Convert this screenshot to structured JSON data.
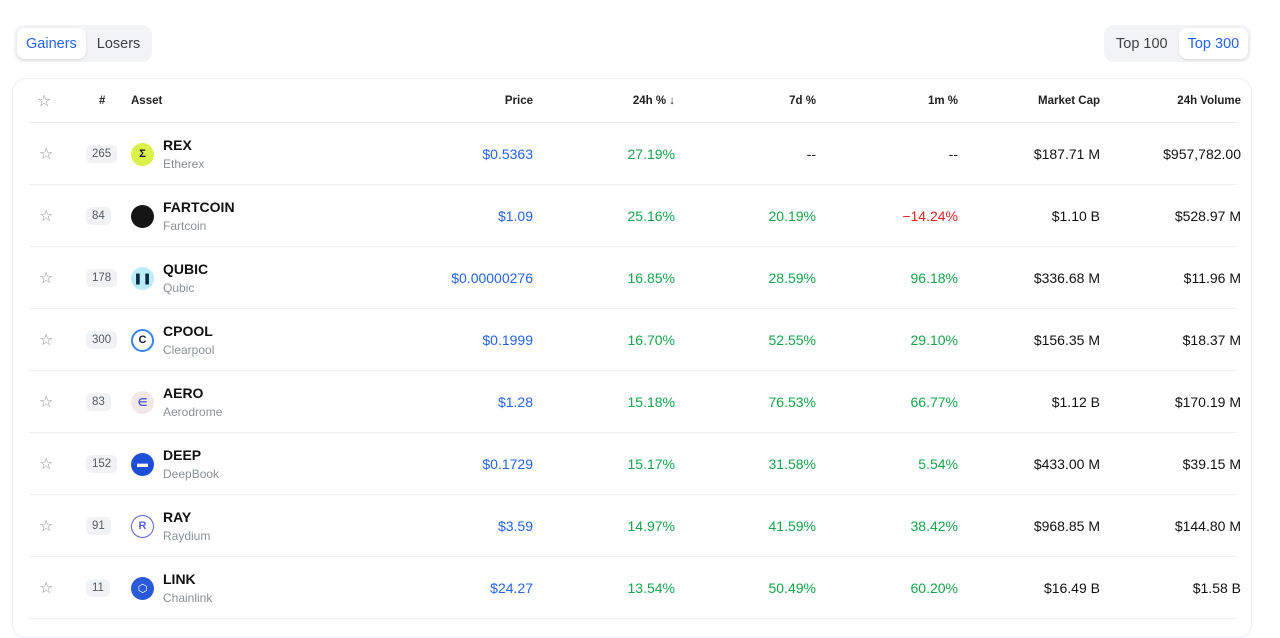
{
  "tabs": {
    "gainers": "Gainers",
    "losers": "Losers"
  },
  "filters": {
    "top100": "Top 100",
    "top300": "Top 300"
  },
  "headers": {
    "rank": "#",
    "asset": "Asset",
    "price": "Price",
    "change_24h": "24h % ↓",
    "change_7d": "7d %",
    "change_1m": "1m %",
    "market_cap": "Market Cap",
    "volume_24h": "24h Volume"
  },
  "colors": {
    "accent": "#2563eb",
    "positive": "#16a34a",
    "negative": "#dc2626"
  },
  "rows": [
    {
      "rank": "265",
      "symbol": "REX",
      "name": "Etherex",
      "price": "$0.5363",
      "d24": "27.19%",
      "d7": "--",
      "m1": "--",
      "mcap": "$187.71 M",
      "vol": "$957,782.00",
      "icon": "sigma-icon"
    },
    {
      "rank": "84",
      "symbol": "FARTCOIN",
      "name": "Fartcoin",
      "price": "$1.09",
      "d24": "25.16%",
      "d7": "20.19%",
      "m1": "−14.24%",
      "mcap": "$1.10 B",
      "vol": "$528.97 M",
      "icon": "dark-circle-icon"
    },
    {
      "rank": "178",
      "symbol": "QUBIC",
      "name": "Qubic",
      "price": "$0.00000276",
      "d24": "16.85%",
      "d7": "28.59%",
      "m1": "96.18%",
      "mcap": "$336.68 M",
      "vol": "$11.96 M",
      "icon": "bars-icon"
    },
    {
      "rank": "300",
      "symbol": "CPOOL",
      "name": "Clearpool",
      "price": "$0.1999",
      "d24": "16.70%",
      "d7": "52.55%",
      "m1": "29.10%",
      "mcap": "$156.35 M",
      "vol": "$18.37 M",
      "icon": "c-icon"
    },
    {
      "rank": "83",
      "symbol": "AERO",
      "name": "Aerodrome",
      "price": "$1.28",
      "d24": "15.18%",
      "d7": "76.53%",
      "m1": "66.77%",
      "mcap": "$1.12 B",
      "vol": "$170.19 M",
      "icon": "aero-icon"
    },
    {
      "rank": "152",
      "symbol": "DEEP",
      "name": "DeepBook",
      "price": "$0.1729",
      "d24": "15.17%",
      "d7": "31.58%",
      "m1": "5.54%",
      "mcap": "$433.00 M",
      "vol": "$39.15 M",
      "icon": "deepbook-icon"
    },
    {
      "rank": "91",
      "symbol": "RAY",
      "name": "Raydium",
      "price": "$3.59",
      "d24": "14.97%",
      "d7": "41.59%",
      "m1": "38.42%",
      "mcap": "$968.85 M",
      "vol": "$144.80 M",
      "icon": "raydium-icon"
    },
    {
      "rank": "11",
      "symbol": "LINK",
      "name": "Chainlink",
      "price": "$24.27",
      "d24": "13.54%",
      "d7": "50.49%",
      "m1": "60.20%",
      "mcap": "$16.49 B",
      "vol": "$1.58 B",
      "icon": "chainlink-icon"
    }
  ]
}
